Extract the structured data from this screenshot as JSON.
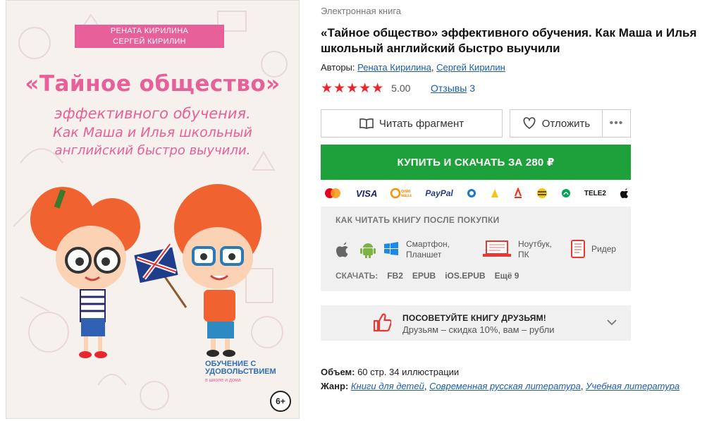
{
  "cover": {
    "authors_line1": "РЕНАТА КИРИЛИНА",
    "authors_line2": "СЕРГЕЙ КИРИЛИН",
    "title_line1": "«Тайное общество»",
    "title_line2": "эффективного обучения.",
    "title_line3": "Как Маша и Илья школьный",
    "title_line4": "английский быстро выучили.",
    "publisher_line1": "ОБУЧЕНИЕ С",
    "publisher_line2": "УДОВОЛЬСТВИЕМ",
    "publisher_line3": "в школе и дома",
    "age": "6+"
  },
  "breadcrumb": "Электронная книга",
  "title": "«Тайное общество» эффективного обучения. Как Маша и Илья школьный английский быстро выучили",
  "authors": {
    "label": "Авторы:",
    "items": [
      "Рената Кирилина",
      "Сергей Кирилин"
    ],
    "sep": ","
  },
  "rating": {
    "stars": "★★★★★",
    "value": "5.00",
    "reviews_label": "Отзывы",
    "reviews_count": "3"
  },
  "actions": {
    "read_fragment": "Читать фрагмент",
    "postpone": "Отложить",
    "more": "•••",
    "buy": "КУПИТЬ И СКАЧАТЬ ЗА 280 ₽"
  },
  "payments": [
    "MasterCard",
    "VISA",
    "QIWI WALLET",
    "PayPal",
    "WebMoney",
    "Яндекс.Деньги",
    "Альфа-Банк",
    "Билайн",
    "Мегафон",
    "TELE2",
    "Apple Pay"
  ],
  "howto": {
    "heading": "КАК ЧИТАТЬ КНИГУ ПОСЛЕ ПОКУПКИ",
    "devices": [
      {
        "label1": "Смартфон,",
        "label2": "Планшет"
      },
      {
        "label1": "Ноутбук,",
        "label2": "ПК"
      },
      {
        "label1": "Ридер",
        "label2": ""
      }
    ],
    "download_label": "СКАЧАТЬ:",
    "formats": [
      "FB2",
      "EPUB",
      "iOS.EPUB",
      "Ещё 9"
    ]
  },
  "recommend": {
    "heading": "ПОСОВЕТУЙТЕ КНИГУ ДРУЗЬЯМ!",
    "sub": "Друзьям – скидка 10%, вам – рубли"
  },
  "meta": {
    "volume_label": "Объем:",
    "volume_value": "60 стр. 34 иллюстрации",
    "genre_label": "Жанр:",
    "genres": [
      "Книги для детей",
      "Современная русская литература",
      "Учебная литература"
    ]
  },
  "colors": {
    "accent_pink": "#e8609a",
    "buy_green": "#1ea03a",
    "star_red": "#e8262e",
    "link_blue": "#1a5bb8"
  }
}
